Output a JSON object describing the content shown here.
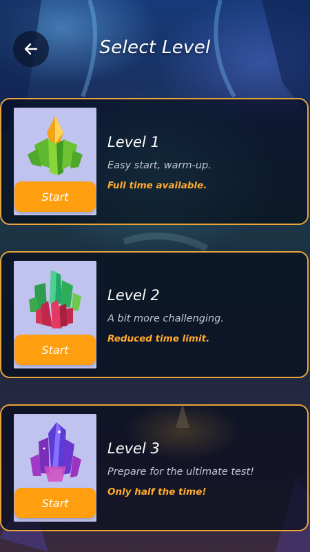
{
  "header": {
    "title": "Select Level",
    "back_icon": "arrow-left-icon"
  },
  "levels": [
    {
      "title": "Level 1",
      "description": "Easy start, warm-up.",
      "note": "Full time available.",
      "button_label": "Start",
      "gem_icon": "green-orange-crystal-icon"
    },
    {
      "title": "Level 2",
      "description": "A bit more challenging.",
      "note": "Reduced time limit.",
      "button_label": "Start",
      "gem_icon": "green-red-crystal-icon"
    },
    {
      "title": "Level 3",
      "description": "Prepare for the ultimate test!",
      "note": "Only half the time!",
      "button_label": "Start",
      "gem_icon": "purple-crystal-icon"
    }
  ],
  "colors": {
    "accent_orange": "#ff9f0f",
    "card_border": "#e9a43a",
    "note_text": "#ffab2e",
    "thumb_bg": "#c0c3ee"
  }
}
